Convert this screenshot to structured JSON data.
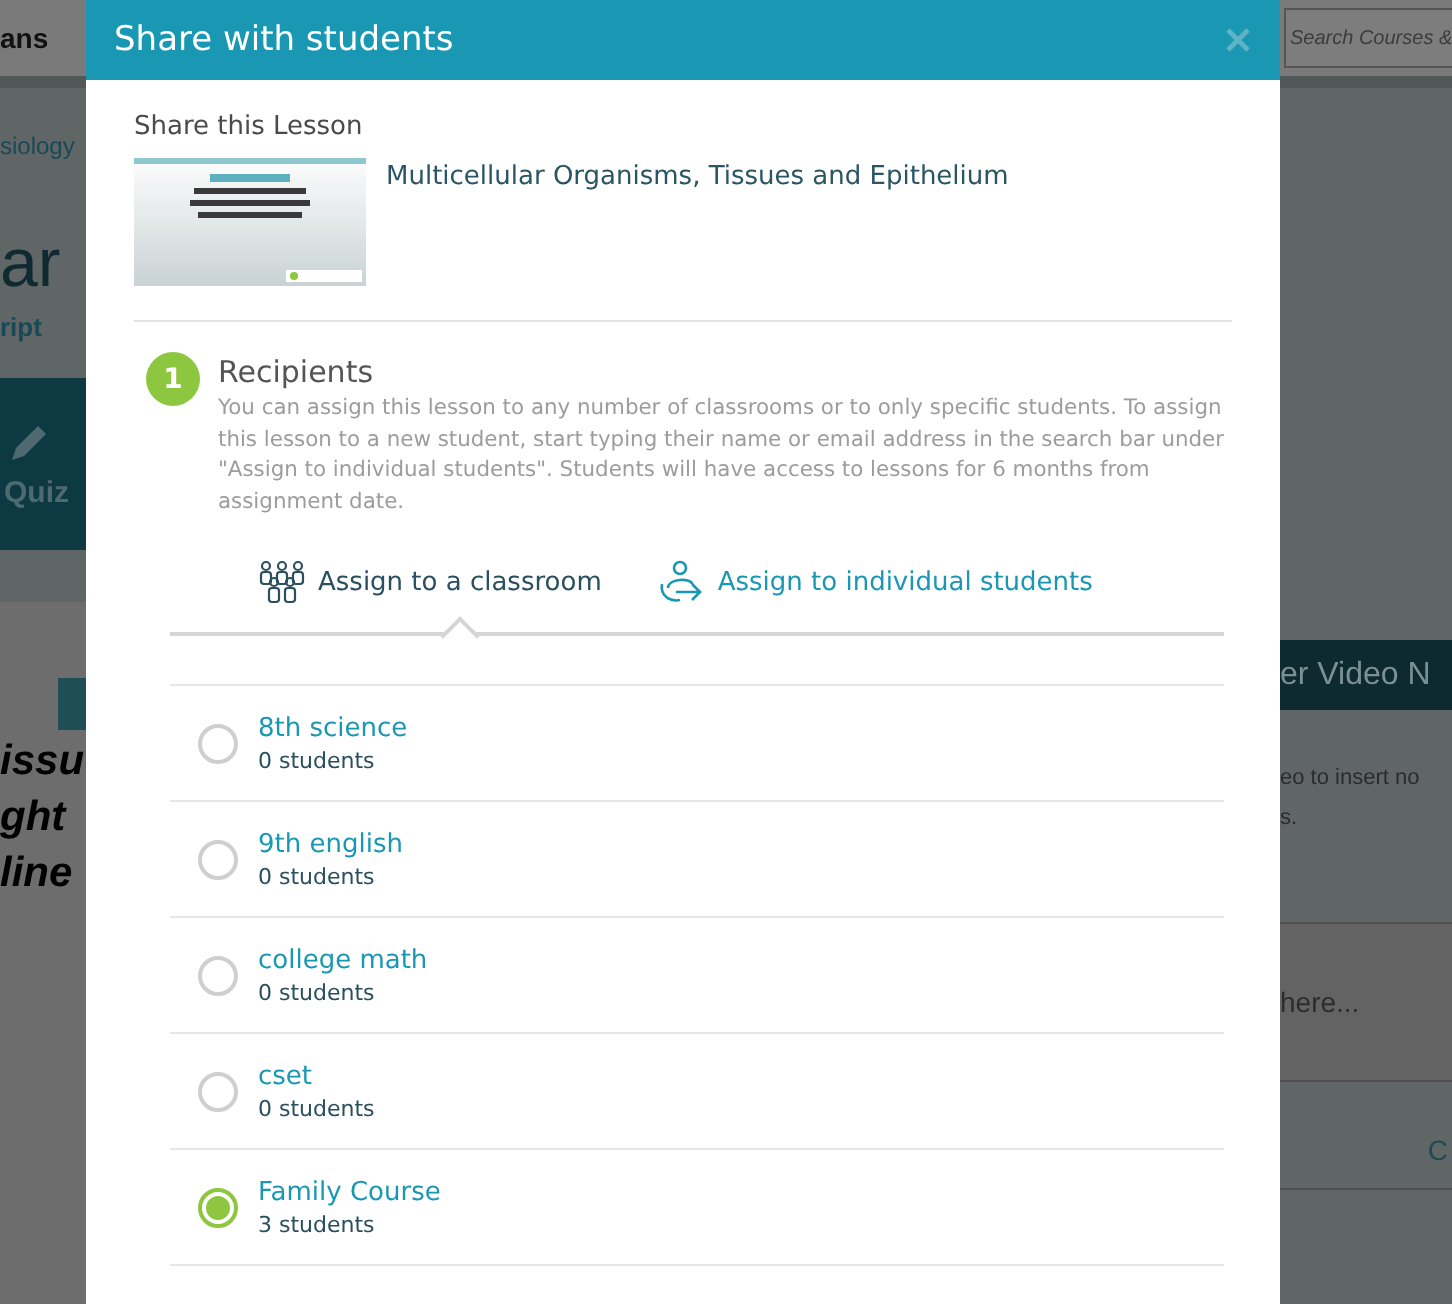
{
  "background": {
    "top_bar_text": "ans",
    "search": {
      "placeholder": "Search Courses &"
    },
    "breadcrumb": "siology",
    "heading": "ar",
    "transcript_link": "ript",
    "quiz_button": "Quiz",
    "slide_lines": [
      "issu",
      "ght",
      "line"
    ],
    "panel_title": "er Video N",
    "panel_lines": [
      "eo to insert no",
      "s."
    ],
    "note_placeholder": "here...",
    "panel_button": "C"
  },
  "modal": {
    "title": "Share with students",
    "section_label": "Share this Lesson",
    "lesson": {
      "title": "Multicellular Organisms, Tissues and Epithelium"
    },
    "step": {
      "number": "1",
      "title": "Recipients",
      "description": "You can assign this lesson to any number of classrooms or to only specific students. To assign this lesson to a new student, start typing their name or email address in the search bar under \"Assign to individual students\". Students will have access to lessons for 6 months from assignment date."
    },
    "tabs": [
      {
        "kind": "classroom",
        "label": "Assign to a classroom",
        "selected": true
      },
      {
        "kind": "individual",
        "label": "Assign to individual students",
        "selected": false
      }
    ],
    "classrooms": [
      {
        "name": "8th science",
        "count": "0 students",
        "selected": false
      },
      {
        "name": "9th english",
        "count": "0 students",
        "selected": false
      },
      {
        "name": "college math",
        "count": "0 students",
        "selected": false
      },
      {
        "name": "cset",
        "count": "0 students",
        "selected": false
      },
      {
        "name": "Family Course",
        "count": "3 students",
        "selected": true
      }
    ]
  }
}
